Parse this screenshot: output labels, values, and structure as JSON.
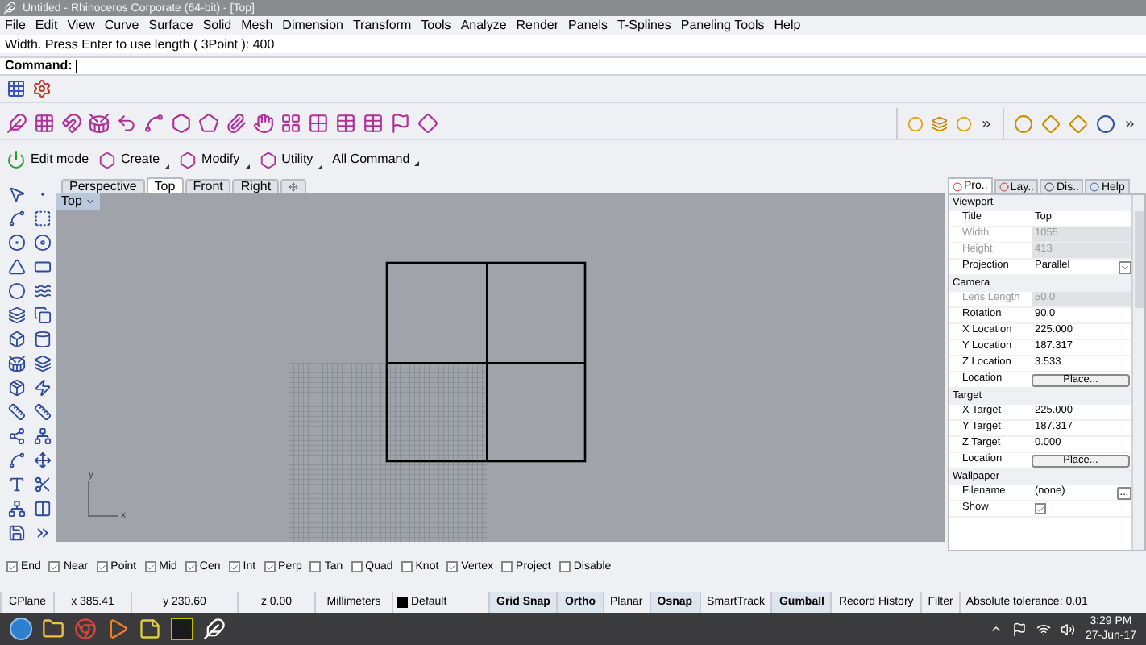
{
  "window": {
    "title": "Untitled - Rhinoceros Corporate (64-bit) - [Top]"
  },
  "menu": [
    "File",
    "Edit",
    "View",
    "Curve",
    "Surface",
    "Solid",
    "Mesh",
    "Dimension",
    "Transform",
    "Tools",
    "Analyze",
    "Render",
    "Panels",
    "T-Splines",
    "Paneling Tools",
    "Help"
  ],
  "command_history": "Width. Press Enter to use length ( 3Point ): 400",
  "command": {
    "label": "Command:"
  },
  "edit_toolbar": [
    {
      "label": "Edit mode",
      "kind": "toggle"
    },
    {
      "label": "Create",
      "kind": "menu"
    },
    {
      "label": "Modify",
      "kind": "menu"
    },
    {
      "label": "Utility",
      "kind": "menu"
    },
    {
      "label": "All Command",
      "kind": "menu"
    }
  ],
  "viewport_tabs": [
    {
      "label": "Perspective",
      "selected": false
    },
    {
      "label": "Top",
      "selected": true
    },
    {
      "label": "Front",
      "selected": false
    },
    {
      "label": "Right",
      "selected": false
    }
  ],
  "viewport": {
    "label": "Top",
    "axis_x": "x",
    "axis_y": "y"
  },
  "panel_tabs": [
    {
      "label": "Pro..",
      "selected": true
    },
    {
      "label": "Lay..",
      "selected": false
    },
    {
      "label": "Dis..",
      "selected": false
    },
    {
      "label": "Help",
      "selected": false
    }
  ],
  "properties": [
    {
      "section": "Viewport",
      "rows": [
        {
          "label": "Title",
          "value": "Top",
          "kind": "text",
          "disabled": false
        },
        {
          "label": "Width",
          "value": "1055",
          "kind": "text",
          "disabled": true
        },
        {
          "label": "Height",
          "value": "413",
          "kind": "text",
          "disabled": true
        },
        {
          "label": "Projection",
          "value": "Parallel",
          "kind": "dropdown",
          "disabled": false
        }
      ]
    },
    {
      "section": "Camera",
      "rows": [
        {
          "label": "Lens Length",
          "value": "50.0",
          "kind": "text",
          "disabled": true
        },
        {
          "label": "Rotation",
          "value": "90.0",
          "kind": "text",
          "disabled": false
        },
        {
          "label": "X Location",
          "value": "225.000",
          "kind": "text",
          "disabled": false
        },
        {
          "label": "Y Location",
          "value": "187.317",
          "kind": "text",
          "disabled": false
        },
        {
          "label": "Z Location",
          "value": "3.533",
          "kind": "text",
          "disabled": false
        },
        {
          "label": "Location",
          "value": "Place...",
          "kind": "button",
          "disabled": false
        }
      ]
    },
    {
      "section": "Target",
      "rows": [
        {
          "label": "X Target",
          "value": "225.000",
          "kind": "text",
          "disabled": false
        },
        {
          "label": "Y Target",
          "value": "187.317",
          "kind": "text",
          "disabled": false
        },
        {
          "label": "Z Target",
          "value": "0.000",
          "kind": "text",
          "disabled": false
        },
        {
          "label": "Location",
          "value": "Place...",
          "kind": "button",
          "disabled": false
        }
      ]
    },
    {
      "section": "Wallpaper",
      "rows": [
        {
          "label": "Filename",
          "value": "(none)",
          "button": "...",
          "kind": "browse",
          "disabled": false
        },
        {
          "label": "Show",
          "kind": "checkbox",
          "checked": true,
          "disabled": false
        }
      ]
    }
  ],
  "osnaps": [
    {
      "label": "End",
      "checked": true
    },
    {
      "label": "Near",
      "checked": true
    },
    {
      "label": "Point",
      "checked": true
    },
    {
      "label": "Mid",
      "checked": true
    },
    {
      "label": "Cen",
      "checked": true
    },
    {
      "label": "Int",
      "checked": true
    },
    {
      "label": "Perp",
      "checked": true
    },
    {
      "label": "Tan",
      "checked": false
    },
    {
      "label": "Quad",
      "checked": false
    },
    {
      "label": "Knot",
      "checked": false
    },
    {
      "label": "Vertex",
      "checked": true
    },
    {
      "label": "Project",
      "checked": false
    },
    {
      "label": "Disable",
      "checked": false
    }
  ],
  "status_bar": [
    {
      "label": "CPlane",
      "kind": "text"
    },
    {
      "label": "x 385.41",
      "kind": "text"
    },
    {
      "label": "y 230.60",
      "kind": "text"
    },
    {
      "label": "z 0.00",
      "kind": "text"
    },
    {
      "label": "Millimeters",
      "kind": "text"
    },
    {
      "label": "Default",
      "kind": "layer",
      "color": "#000000"
    },
    {
      "label": "Grid Snap",
      "kind": "toggle",
      "on": true
    },
    {
      "label": "Ortho",
      "kind": "toggle",
      "on": true
    },
    {
      "label": "Planar",
      "kind": "toggle",
      "on": false
    },
    {
      "label": "Osnap",
      "kind": "toggle",
      "on": true
    },
    {
      "label": "SmartTrack",
      "kind": "toggle",
      "on": false
    },
    {
      "label": "Gumball",
      "kind": "toggle",
      "on": true
    },
    {
      "label": "Record History",
      "kind": "toggle",
      "on": false
    },
    {
      "label": "Filter",
      "kind": "toggle",
      "on": false
    },
    {
      "label": "Absolute tolerance: 0.01",
      "kind": "text"
    }
  ],
  "taskbar": {
    "time": "3:29 PM",
    "date": "27-Jun-17"
  }
}
